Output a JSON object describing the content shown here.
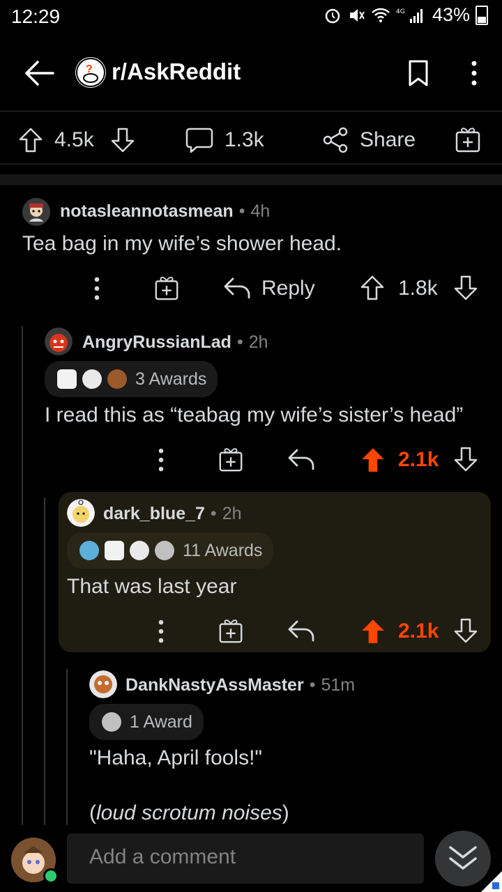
{
  "status_bar": {
    "time": "12:29",
    "battery": "43%"
  },
  "header": {
    "subreddit": "r/AskReddit"
  },
  "post_actions": {
    "upvotes": "4.5k",
    "comments": "1.3k",
    "share_label": "Share"
  },
  "comments": [
    {
      "username": "notasleannotasmean",
      "age": "4h",
      "body": "Tea bag in my wife’s shower head.",
      "reply_label": "Reply",
      "score": "1.8k",
      "avatar_color": "#c9c9c9"
    },
    {
      "username": "AngryRussianLad",
      "age": "2h",
      "awards_text": "3 Awards",
      "body": "I read this as “teabag my wife’s sister’s head”",
      "score": "2.1k",
      "avatar_color": "#d9351c"
    },
    {
      "username": "dark_blue_7",
      "age": "2h",
      "awards_text": "11 Awards",
      "body": "That was last year",
      "score": "2.1k",
      "avatar_color": "#f1d36b"
    },
    {
      "username": "DankNastyAssMaster",
      "age": "51m",
      "awards_text": "1 Award",
      "body_line1": "\"Haha, April fools!\"",
      "body_line2": "loud scrotum noises",
      "avatar_color": "#c46b2f"
    }
  ],
  "bottom_bar": {
    "placeholder": "Add a comment"
  },
  "colors": {
    "upvote_active": "#ff4500",
    "background": "#000000",
    "highlight": "#1f1c11"
  }
}
